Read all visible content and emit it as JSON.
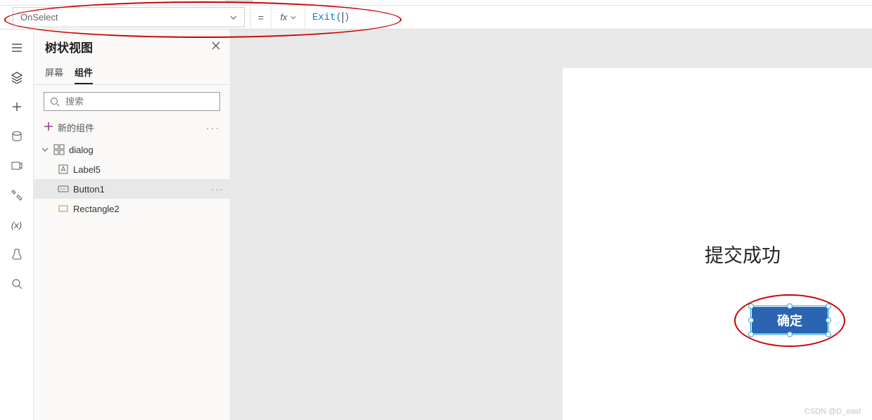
{
  "formula_bar": {
    "property_name": "OnSelect",
    "equals": "=",
    "fx_label": "fx",
    "formula_function": "Exit",
    "formula_args_display": "()"
  },
  "tree_panel": {
    "title": "树状视图",
    "tabs": {
      "screen": "屏幕",
      "components": "组件",
      "active": "components"
    },
    "search_placeholder": "搜索",
    "new_component_label": "新的组件",
    "root": {
      "name": "dialog"
    },
    "items": [
      {
        "name": "Label5",
        "type": "label",
        "selected": false
      },
      {
        "name": "Button1",
        "type": "button",
        "selected": true
      },
      {
        "name": "Rectangle2",
        "type": "rectangle",
        "selected": false
      }
    ]
  },
  "canvas": {
    "label_text": "提交成功",
    "button_text": "确定"
  },
  "watermark": "CSDN @D_east"
}
